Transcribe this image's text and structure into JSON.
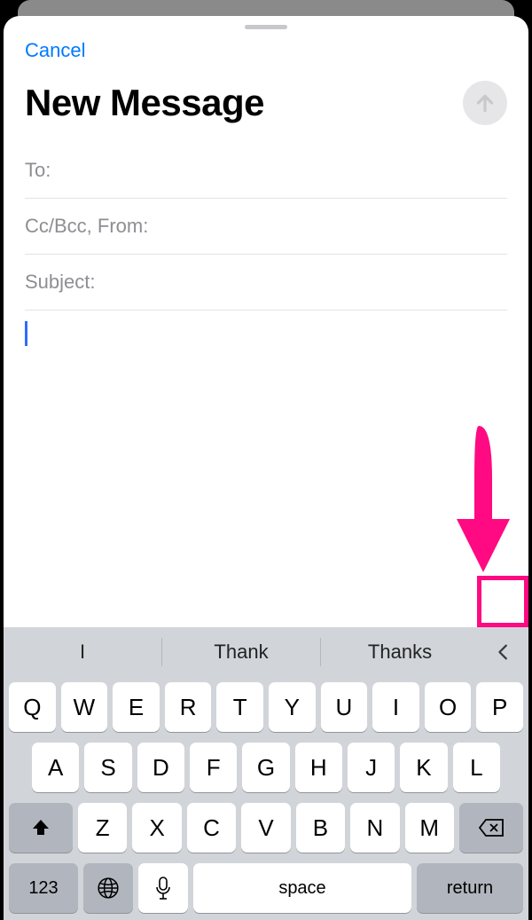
{
  "header": {
    "cancel_label": "Cancel",
    "title": "New Message"
  },
  "fields": {
    "to_label": "To:",
    "ccbcc_label": "Cc/Bcc, From:",
    "subject_label": "Subject:"
  },
  "keyboard": {
    "suggestions": [
      "I",
      "Thank",
      "Thanks"
    ],
    "row1": [
      "Q",
      "W",
      "E",
      "R",
      "T",
      "Y",
      "U",
      "I",
      "O",
      "P"
    ],
    "row2": [
      "A",
      "S",
      "D",
      "F",
      "G",
      "H",
      "J",
      "K",
      "L"
    ],
    "row3": [
      "Z",
      "X",
      "C",
      "V",
      "B",
      "N",
      "M"
    ],
    "numbers_key": "123",
    "space_key": "space",
    "return_key": "return"
  }
}
